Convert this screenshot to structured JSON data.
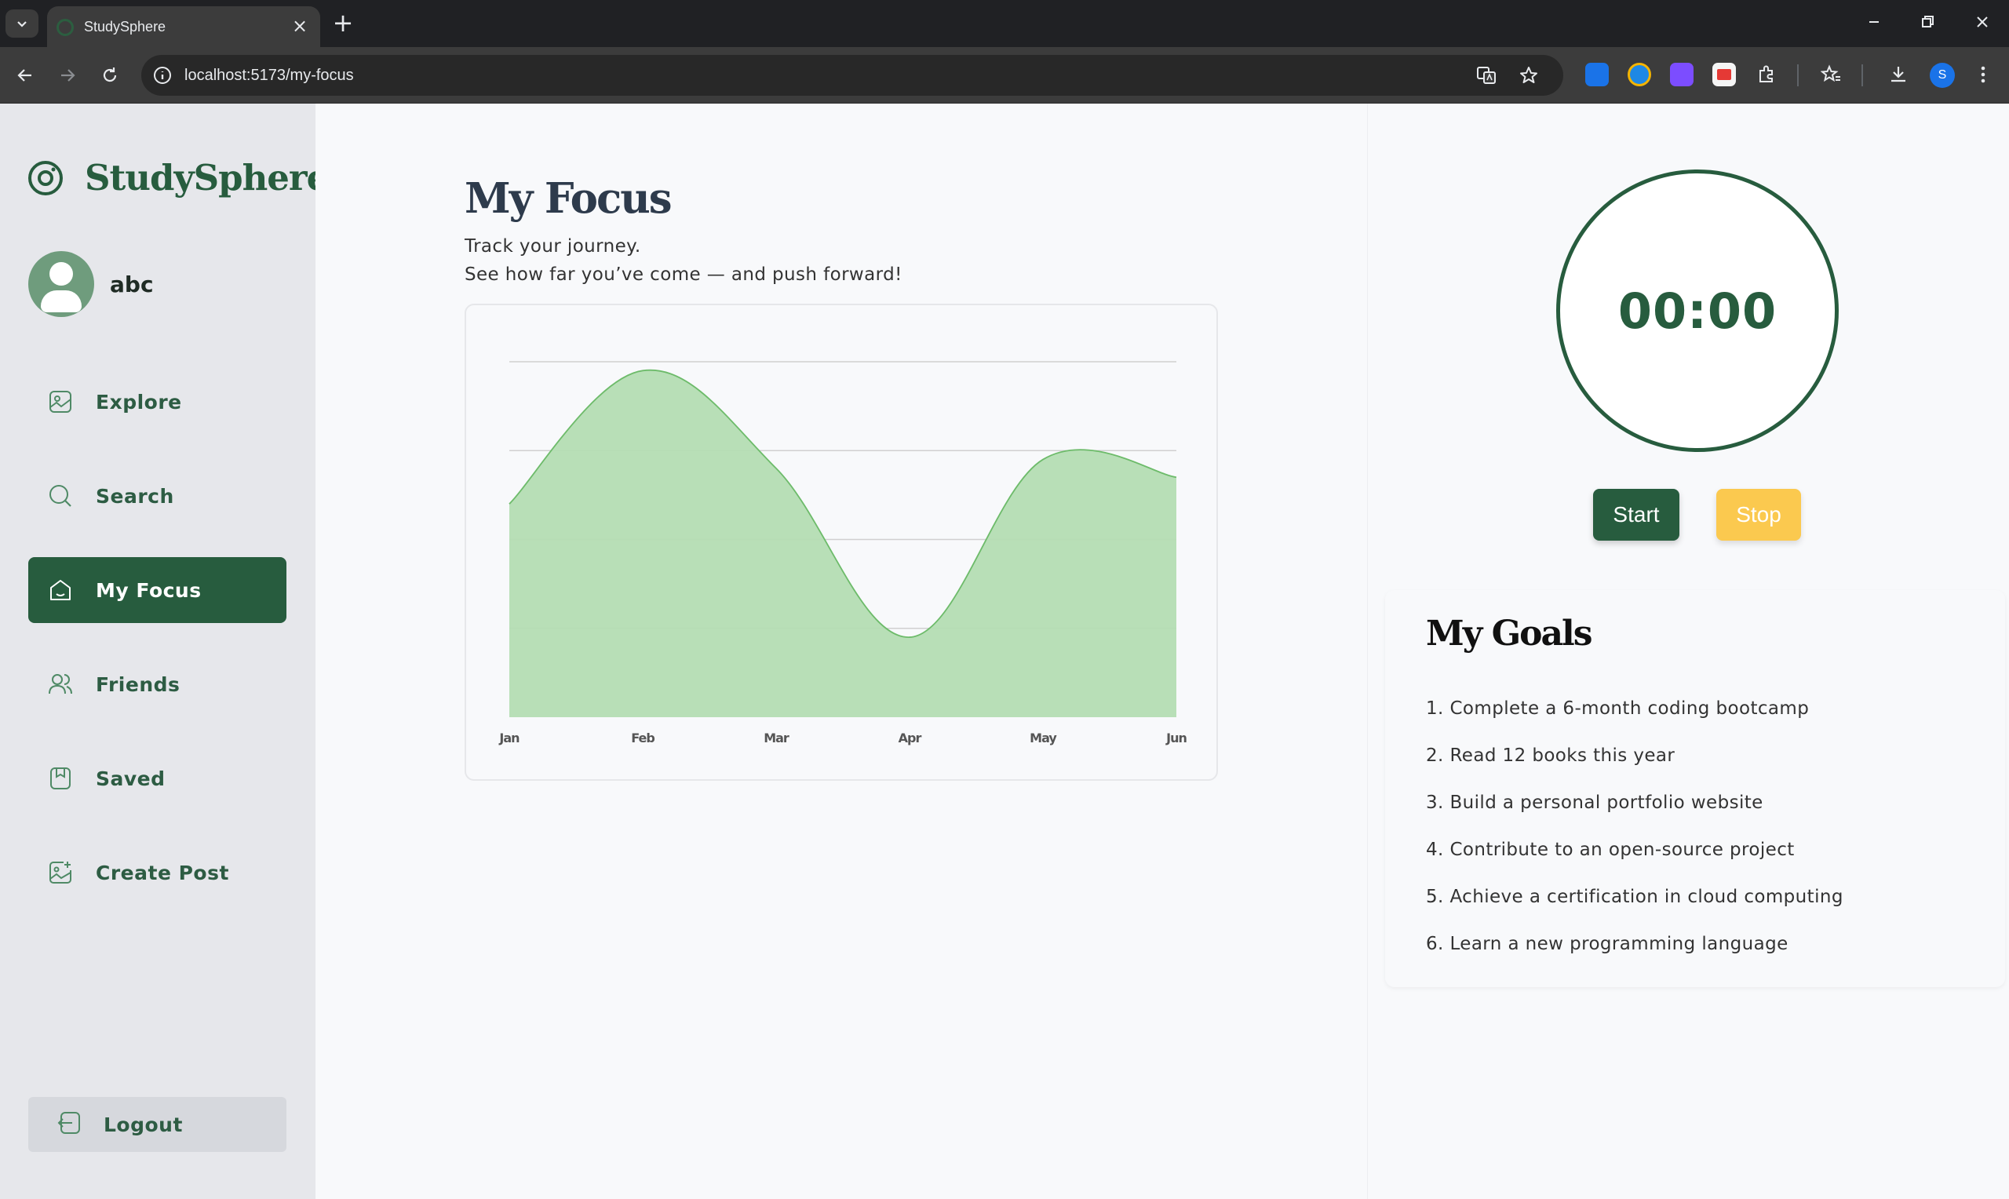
{
  "browser": {
    "tab_title": "StudySphere",
    "url": "localhost:5173/my-focus",
    "profile_initial": "S"
  },
  "sidebar": {
    "brand": "StudySphere",
    "username": "abc",
    "items": [
      {
        "label": "Explore",
        "icon": "image-frame-icon"
      },
      {
        "label": "Search",
        "icon": "search-icon"
      },
      {
        "label": "My Focus",
        "icon": "home-icon",
        "active": true
      },
      {
        "label": "Friends",
        "icon": "users-icon"
      },
      {
        "label": "Saved",
        "icon": "bookmark-icon"
      },
      {
        "label": "Create Post",
        "icon": "image-plus-icon"
      }
    ],
    "logout_label": "Logout"
  },
  "main": {
    "title": "My Focus",
    "subtitle_line1": "Track your journey.",
    "subtitle_line2": "See how far you’ve come — and push forward!"
  },
  "chart_data": {
    "type": "area",
    "categories": [
      "Jan",
      "Feb",
      "Mar",
      "Apr",
      "May",
      "Jun"
    ],
    "series": [
      {
        "values": [
          2.4,
          3.9,
          2.8,
          0.9,
          2.9,
          2.7
        ]
      }
    ],
    "ylim": [
      0,
      4
    ],
    "grid": true,
    "title": "",
    "xlabel": "",
    "ylabel": "",
    "colors": {
      "fill": "#b4ddb3",
      "stroke": "#6dbb6a",
      "grid": "#d0d0d0"
    }
  },
  "timer": {
    "display": "00:00",
    "start_label": "Start",
    "stop_label": "Stop"
  },
  "goals": {
    "title": "My Goals",
    "items": [
      "1. Complete a 6-month coding bootcamp",
      "2. Read 12 books this year",
      "3. Build a personal portfolio website",
      "4. Contribute to an open-source project",
      "5. Achieve a certification in cloud computing",
      "6. Learn a new programming language"
    ]
  },
  "colors": {
    "brand": "#275c3e",
    "stop_button": "#fbc94f",
    "sidebar_bg": "#e6e7eb"
  }
}
